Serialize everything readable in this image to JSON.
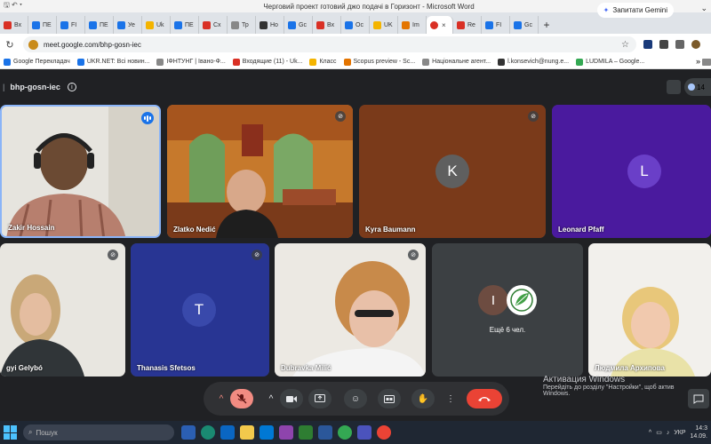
{
  "word": {
    "title": "Черговий проект готовий джо подачі в Горизонт  -  Microsoft Word",
    "qa": "🖫 ↶ ▾"
  },
  "browser": {
    "tabs": [
      {
        "label": "Вх",
        "color": "#d93025"
      },
      {
        "label": "ПЕ",
        "color": "#1a73e8"
      },
      {
        "label": "FI",
        "color": "#1a73e8"
      },
      {
        "label": "ПЕ",
        "color": "#1a73e8"
      },
      {
        "label": "Уе",
        "color": "#1a73e8"
      },
      {
        "label": "Uk",
        "color": "#f4b400"
      },
      {
        "label": "ПЕ",
        "color": "#1a73e8"
      },
      {
        "label": "Сх",
        "color": "#d93025"
      },
      {
        "label": "Тр",
        "color": "#888888"
      },
      {
        "label": "Но",
        "color": "#333333"
      },
      {
        "label": "Gc",
        "color": "#1a73e8"
      },
      {
        "label": "Вх",
        "color": "#d93025"
      },
      {
        "label": "Ос",
        "color": "#1a73e8"
      },
      {
        "label": "UK",
        "color": "#f4b400"
      },
      {
        "label": "Im",
        "color": "#e37400"
      }
    ],
    "active_tab": {
      "label": "",
      "color": "#d93025"
    },
    "tabs_after": [
      {
        "label": "Re",
        "color": "#d93025"
      },
      {
        "label": "FI",
        "color": "#1a73e8"
      },
      {
        "label": "Gc",
        "color": "#1a73e8"
      }
    ],
    "gemini": "Запитати Gemini",
    "url": "meet.google.com/bhp-gosn-iec",
    "bookmarks": [
      {
        "label": "Google Перекладач",
        "color": "#1a73e8"
      },
      {
        "label": "UKR.NET: Всі новин...",
        "color": "#1a73e8"
      },
      {
        "label": "ІФНТУНГ | Івано-Ф...",
        "color": "#888888"
      },
      {
        "label": "Входящие (11) - Uk...",
        "color": "#d93025"
      },
      {
        "label": "Класс",
        "color": "#f4b400"
      },
      {
        "label": "Scopus preview - Sc...",
        "color": "#e37400"
      },
      {
        "label": "Національне агент...",
        "color": "#888888"
      },
      {
        "label": "l.konsevich@nung.e...",
        "color": "#333333"
      },
      {
        "label": "LUDMILA – Google...",
        "color": "#34a853"
      }
    ],
    "bookmarks_more": "»"
  },
  "meet": {
    "code": "bhp-gosn-iec",
    "participant_count": "14",
    "participants": [
      {
        "name": "Zakir Hossain"
      },
      {
        "name": "Zlatko Nedić"
      },
      {
        "name": "Kyra Baumann",
        "initial": "K"
      },
      {
        "name": "Leonard Pfaff",
        "initial": "L"
      },
      {
        "name": "gyi Gelybó"
      },
      {
        "name": "Thanasis Sfetsos",
        "initial": "T"
      },
      {
        "name": "Dubravka Milić"
      },
      {
        "name": "Людмила Архипова"
      }
    ],
    "others": {
      "initial": "I",
      "label": "Ещё 6 чел."
    },
    "colors": {
      "k_bg": "#7a3a1a",
      "k_avatar": "#5f5f5f",
      "l_bg": "#4a1a9e",
      "l_avatar": "#6a3fc8",
      "t_bg": "#283593",
      "t_avatar": "#3949ab"
    }
  },
  "watermark": {
    "title": "Активация Windows",
    "line": "Перейдіть до розділу \"Настройки\", щоб актив",
    "line2": "Windows."
  },
  "taskbar": {
    "search": "Пошук",
    "lang": "УКР",
    "time": "14:3",
    "date": "14.09."
  }
}
